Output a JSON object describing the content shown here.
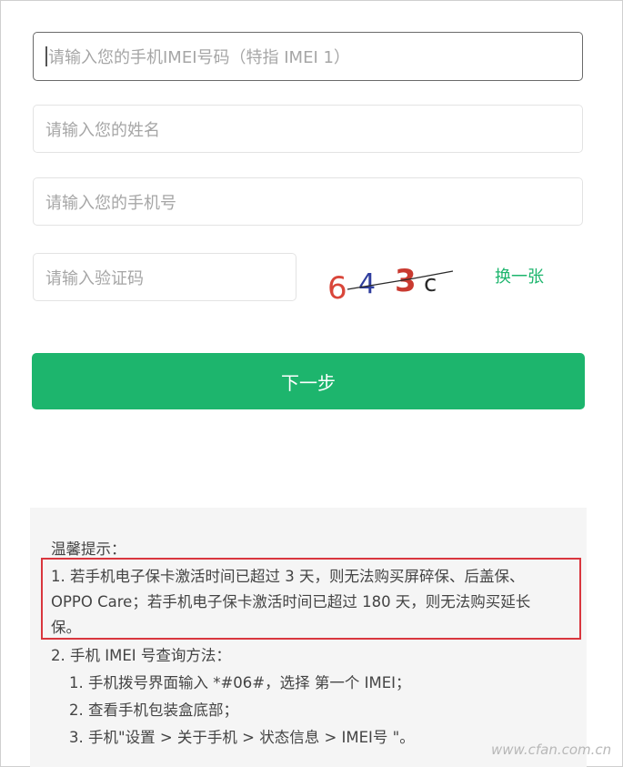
{
  "form": {
    "imei_placeholder": "请输入您的手机IMEI号码（特指 IMEI 1）",
    "name_placeholder": "请输入您的姓名",
    "phone_placeholder": "请输入您的手机号",
    "captcha_placeholder": "请输入验证码",
    "captcha_code": [
      "6",
      "4",
      "3",
      "c"
    ],
    "refresh_label": "换一张",
    "next_label": "下一步"
  },
  "tips": {
    "title": "温馨提示：",
    "item1_line1": "1. 若手机电子保卡激活时间已超过 3 天，则无法购买屏碎保、后盖保、",
    "item1_line2": "OPPO Care；若手机电子保卡激活时间已超过 180 天，则无法购买延长",
    "item1_line3": "保。",
    "item2_title": "2. 手机 IMEI 号查询方法：",
    "item2_step1": "1. 手机拨号界面输入 *#06#，选择 第一个 IMEI；",
    "item2_step2": "2. 查看手机包装盒底部；",
    "item2_step3": "3. 手机\"设置 > 关于手机 > 状态信息 > IMEI号 \"。"
  },
  "watermark": "www.cfan.com.cn",
  "colors": {
    "accent": "#1db56d",
    "highlight_border": "#d9363e",
    "tips_background": "#f5f5f5"
  }
}
